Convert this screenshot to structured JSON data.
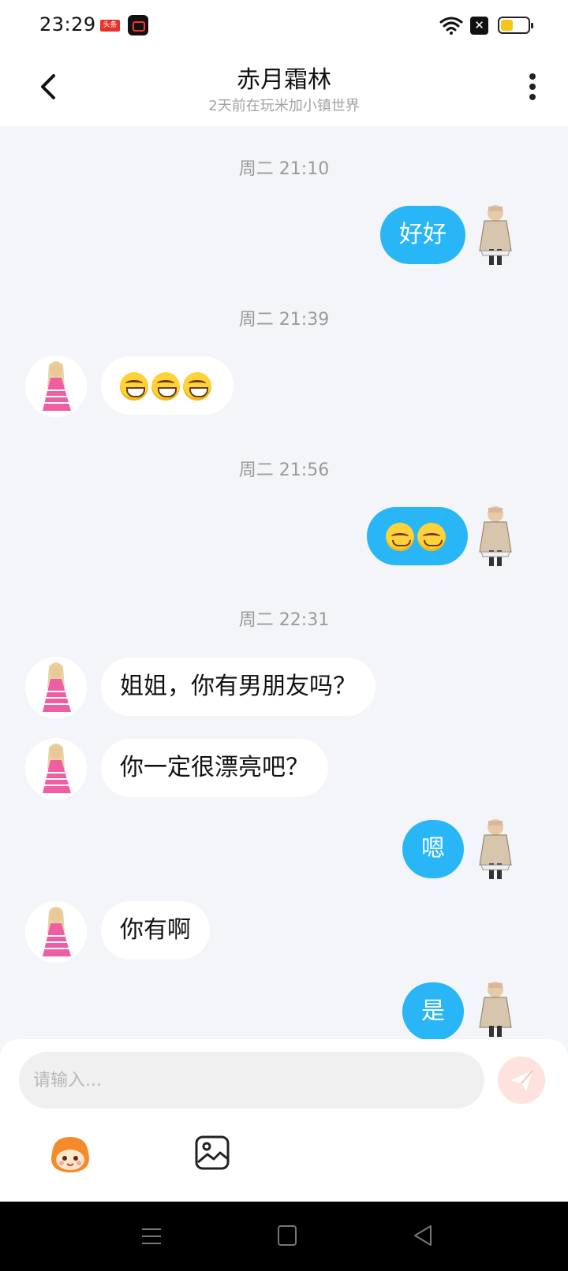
{
  "status_bar": {
    "time": "23:29",
    "news_badge": "头条",
    "battery_percent": 45,
    "battery_color": "#f5c518"
  },
  "header": {
    "title": "赤月霜林",
    "subtitle": "2天前在玩米加小镇世界"
  },
  "messages": {
    "t1": "周二 21:10",
    "m1": "好好",
    "t2": "周二 21:39",
    "t3": "周二 21:56",
    "t4": "周二 22:31",
    "m4": "姐姐，你有男朋友吗？",
    "m5": "你一定很漂亮吧？",
    "m6": "嗯",
    "m7": "你有啊",
    "m8": "是",
    "emoji_grin": "grinning-face-icon",
    "emoji_smile": "smiling-face-icon"
  },
  "input": {
    "placeholder": "请输入..."
  },
  "colors": {
    "outgoing_bubble": "#28b6f6",
    "incoming_bubble": "#ffffff",
    "background": "#f3f5f8",
    "send_button": "#fde2dd"
  }
}
